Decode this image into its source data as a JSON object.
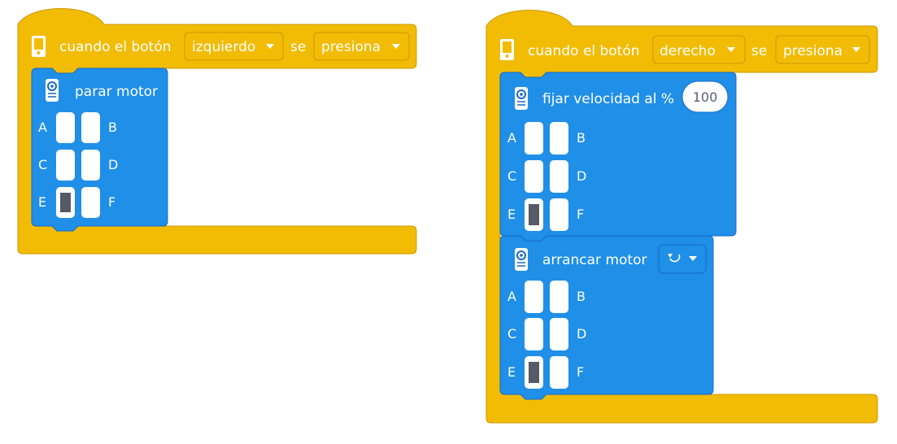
{
  "scripts": [
    {
      "hat": {
        "prefix": "cuando el botón",
        "button_dropdown": "izquierdo",
        "middle": "se",
        "action_dropdown": "presiona"
      },
      "blocks": [
        {
          "label": "parar motor",
          "ports": [
            {
              "left": "A",
              "right": "B",
              "left_selected": false,
              "right_selected": false
            },
            {
              "left": "C",
              "right": "D",
              "left_selected": false,
              "right_selected": false
            },
            {
              "left": "E",
              "right": "F",
              "left_selected": true,
              "right_selected": false
            }
          ]
        }
      ]
    },
    {
      "hat": {
        "prefix": "cuando el botón",
        "button_dropdown": "derecho",
        "middle": "se",
        "action_dropdown": "presiona"
      },
      "blocks": [
        {
          "label": "fijar velocidad al %",
          "value": "100",
          "ports": [
            {
              "left": "A",
              "right": "B",
              "left_selected": false,
              "right_selected": false
            },
            {
              "left": "C",
              "right": "D",
              "left_selected": false,
              "right_selected": false
            },
            {
              "left": "E",
              "right": "F",
              "left_selected": true,
              "right_selected": false
            }
          ]
        },
        {
          "label": "arrancar motor",
          "direction_icon": "rotate-ccw-icon",
          "ports": [
            {
              "left": "A",
              "right": "B",
              "left_selected": false,
              "right_selected": false
            },
            {
              "left": "C",
              "right": "D",
              "left_selected": false,
              "right_selected": false
            },
            {
              "left": "E",
              "right": "F",
              "left_selected": true,
              "right_selected": false
            }
          ]
        }
      ]
    }
  ],
  "colors": {
    "event_fill": "#f2bc05",
    "event_stroke": "#cc9900",
    "motor_fill": "#1f8fe8",
    "motor_stroke": "#1769c6",
    "port_fill": "#ffffff",
    "port_selected": "#555a66"
  }
}
